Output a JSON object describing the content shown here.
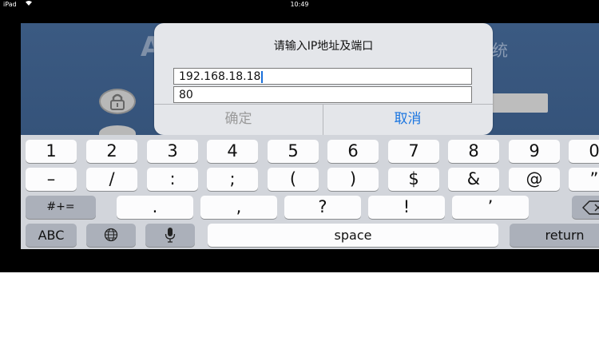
{
  "status_bar": {
    "carrier": "iPad",
    "time": "10:49"
  },
  "background_app": {
    "title_left": "A",
    "title_right": "统"
  },
  "dialog": {
    "title": "请输入IP地址及端口",
    "ip_value": "192.168.18.18",
    "port_value": "80",
    "ok_label": "确定",
    "cancel_label": "取消"
  },
  "keyboard": {
    "row1": [
      "1",
      "2",
      "3",
      "4",
      "5",
      "6",
      "7",
      "8",
      "9",
      "0"
    ],
    "row2": [
      "–",
      "/",
      ":",
      ";",
      "(",
      ")",
      "$",
      "&",
      "@",
      "”"
    ],
    "row3_left": "#+=",
    "row3": [
      ".",
      ",",
      "?",
      "!",
      "’"
    ],
    "row3_right": "delete-icon",
    "row4": {
      "abc": "ABC",
      "globe": "globe-icon",
      "mic": "microphone-icon",
      "space": "space",
      "return": "return"
    }
  },
  "colors": {
    "accent": "#1a75e0",
    "keyboard_bg": "#d2d5db",
    "app_bg": "#34527a"
  }
}
